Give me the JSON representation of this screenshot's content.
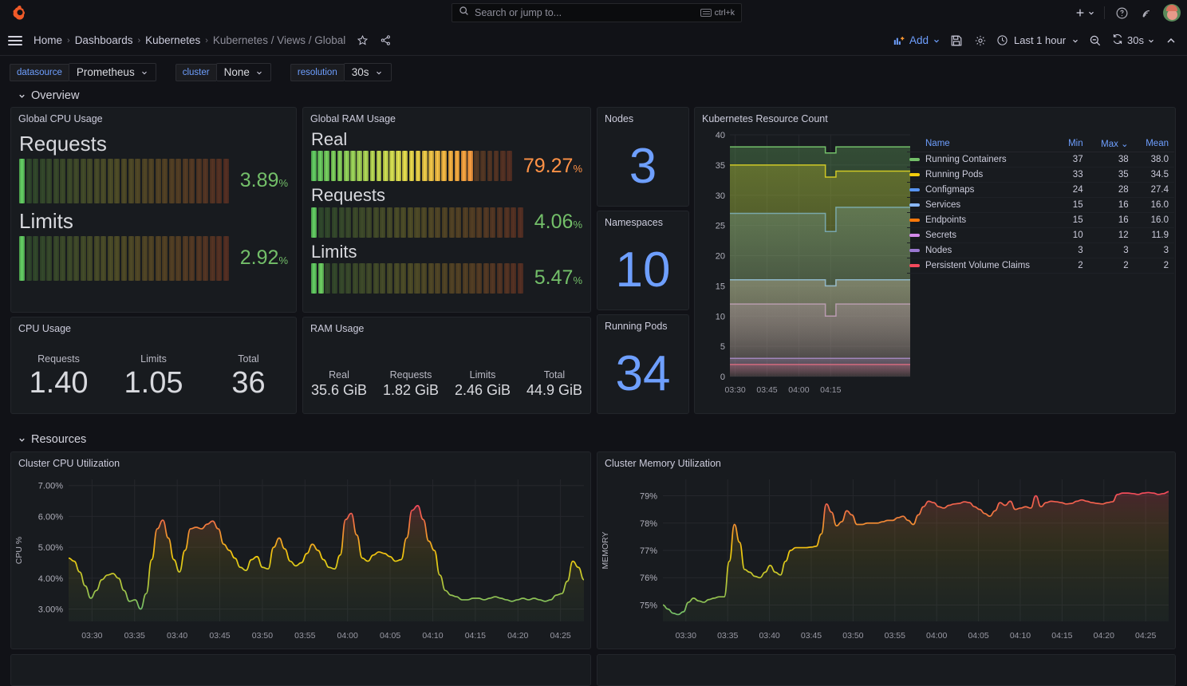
{
  "topnav": {
    "logo_icon": "grafana-logo-icon",
    "search": {
      "placeholder": "Search or jump to...",
      "shortcut": "ctrl+k",
      "icon": "search-icon"
    },
    "add_icon": "plus-icon",
    "help_icon": "help-circle-icon",
    "news_icon": "rss-feed-icon",
    "avatar": "user-avatar"
  },
  "breadcrumb": {
    "menu_icon": "hamburger-menu-icon",
    "items": [
      {
        "label": "Home",
        "current": false
      },
      {
        "label": "Dashboards",
        "current": false
      },
      {
        "label": "Kubernetes",
        "current": false
      },
      {
        "label": "Kubernetes / Views / Global",
        "current": true
      }
    ],
    "separator": "›",
    "star_icon": "star-outline-icon",
    "share_icon": "share-nodes-icon"
  },
  "toolbar": {
    "add_label": "Add",
    "add_icon": "panel-add-icon",
    "save_icon": "save-disk-icon",
    "settings_icon": "gear-icon",
    "time_icon": "clock-icon",
    "time_range": "Last 1 hour",
    "zoom_out_icon": "zoom-out-icon",
    "refresh_icon": "refresh-icon",
    "refresh_interval": "30s",
    "collapse_icon": "chevron-up-icon"
  },
  "variables": [
    {
      "label": "datasource",
      "value": "Prometheus"
    },
    {
      "label": "cluster",
      "value": "None"
    },
    {
      "label": "resolution",
      "value": "30s"
    }
  ],
  "sections": [
    {
      "title": "Overview",
      "collapsed": false
    },
    {
      "title": "Resources",
      "collapsed": false
    }
  ],
  "panels": {
    "global_cpu": {
      "title": "Global CPU Usage",
      "gauges": [
        {
          "label": "Requests",
          "value": "3.89",
          "unit": "%",
          "percent": 3.89,
          "color": "#73bf69"
        },
        {
          "label": "Limits",
          "value": "2.92",
          "unit": "%",
          "percent": 2.92,
          "color": "#73bf69"
        }
      ]
    },
    "global_ram": {
      "title": "Global RAM Usage",
      "gauges": [
        {
          "label": "Real",
          "value": "79.27",
          "unit": "%",
          "percent": 79.27,
          "color": "#ff780a"
        },
        {
          "label": "Requests",
          "value": "4.06",
          "unit": "%",
          "percent": 4.06,
          "color": "#73bf69"
        },
        {
          "label": "Limits",
          "value": "5.47",
          "unit": "%",
          "percent": 5.47,
          "color": "#73bf69"
        }
      ]
    },
    "nodes": {
      "title": "Nodes",
      "value": "3",
      "color": "#6e9fff"
    },
    "namespaces": {
      "title": "Namespaces",
      "value": "10",
      "color": "#6e9fff"
    },
    "running_pods": {
      "title": "Running Pods",
      "value": "34",
      "color": "#6e9fff"
    },
    "cpu_usage": {
      "title": "CPU Usage",
      "stats": [
        {
          "label": "Requests",
          "value": "1.40"
        },
        {
          "label": "Limits",
          "value": "1.05"
        },
        {
          "label": "Total",
          "value": "36"
        }
      ]
    },
    "ram_usage": {
      "title": "RAM Usage",
      "stats": [
        {
          "label": "Real",
          "value": "35.6 GiB"
        },
        {
          "label": "Requests",
          "value": "1.82 GiB"
        },
        {
          "label": "Limits",
          "value": "2.46 GiB"
        },
        {
          "label": "Total",
          "value": "44.9 GiB"
        }
      ]
    },
    "resource_count": {
      "title": "Kubernetes Resource Count"
    },
    "cluster_cpu": {
      "title": "Cluster CPU Utilization"
    },
    "cluster_mem": {
      "title": "Cluster Memory Utilization"
    }
  },
  "chart_data": [
    {
      "id": "resource_count",
      "type": "line",
      "title": "Kubernetes Resource Count",
      "xlabel": "",
      "ylabel": "",
      "ylim": [
        0,
        40
      ],
      "yticks": [
        0,
        5,
        10,
        15,
        20,
        25,
        30,
        35,
        40
      ],
      "xticks": [
        "03:30",
        "03:45",
        "04:00",
        "04:15"
      ],
      "grid": true,
      "legend_position": "right",
      "legend_columns": [
        "Name",
        "Min",
        "Max",
        "Mean"
      ],
      "sort_column": "Max",
      "stepped": true,
      "series": [
        {
          "name": "Running Containers",
          "color": "#73bf69",
          "min": "37",
          "max": "38",
          "mean": "38.0",
          "values": [
            38,
            38,
            38,
            38,
            38,
            38,
            38,
            38,
            38,
            37,
            38,
            38,
            38,
            38,
            38,
            38,
            38,
            38
          ]
        },
        {
          "name": "Running Pods",
          "color": "#f2cc0c",
          "min": "33",
          "max": "35",
          "mean": "34.5",
          "values": [
            35,
            35,
            35,
            35,
            35,
            35,
            35,
            35,
            35,
            33,
            34,
            34,
            34,
            34,
            34,
            34,
            34,
            34
          ]
        },
        {
          "name": "Configmaps",
          "color": "#5794f2",
          "min": "24",
          "max": "28",
          "mean": "27.4",
          "values": [
            27,
            27,
            27,
            27,
            27,
            27,
            27,
            27,
            27,
            24,
            28,
            28,
            28,
            28,
            28,
            28,
            28,
            28
          ]
        },
        {
          "name": "Services",
          "color": "#8ab8ff",
          "min": "15",
          "max": "16",
          "mean": "16.0",
          "values": [
            16,
            16,
            16,
            16,
            16,
            16,
            16,
            16,
            16,
            15,
            16,
            16,
            16,
            16,
            16,
            16,
            16,
            16
          ]
        },
        {
          "name": "Endpoints",
          "color": "#ff780a",
          "min": "15",
          "max": "16",
          "mean": "16.0",
          "values": [
            16,
            16,
            16,
            16,
            16,
            16,
            16,
            16,
            16,
            15,
            16,
            16,
            16,
            16,
            16,
            16,
            16,
            16
          ]
        },
        {
          "name": "Secrets",
          "color": "#d389ea",
          "min": "10",
          "max": "12",
          "mean": "11.9",
          "values": [
            12,
            12,
            12,
            12,
            12,
            12,
            12,
            12,
            12,
            10,
            12,
            12,
            12,
            12,
            12,
            12,
            12,
            12
          ]
        },
        {
          "name": "Nodes",
          "color": "#9a77d1",
          "min": "3",
          "max": "3",
          "mean": "3",
          "values": [
            3,
            3,
            3,
            3,
            3,
            3,
            3,
            3,
            3,
            3,
            3,
            3,
            3,
            3,
            3,
            3,
            3,
            3
          ]
        },
        {
          "name": "Persistent Volume Claims",
          "color": "#f2495c",
          "min": "2",
          "max": "2",
          "mean": "2",
          "values": [
            2,
            2,
            2,
            2,
            2,
            2,
            2,
            2,
            2,
            2,
            2,
            2,
            2,
            2,
            2,
            2,
            2,
            2
          ]
        }
      ]
    },
    {
      "id": "cluster_cpu",
      "type": "area",
      "title": "Cluster CPU Utilization",
      "xlabel": "",
      "ylabel": "CPU %",
      "ylim": [
        2.6,
        7.2
      ],
      "yticks": [
        3.0,
        4.0,
        5.0,
        6.0,
        7.0
      ],
      "ytick_labels": [
        "3.00%",
        "4.00%",
        "5.00%",
        "6.00%",
        "7.00%"
      ],
      "xticks": [
        "03:30",
        "03:35",
        "03:40",
        "03:45",
        "03:50",
        "03:55",
        "04:00",
        "04:05",
        "04:10",
        "04:15",
        "04:20",
        "04:25"
      ],
      "grid": true,
      "gradient_low_color": "#73bf69",
      "gradient_high_color": "#f2495c",
      "values": [
        4.65,
        4.55,
        4.2,
        3.75,
        3.35,
        3.6,
        3.95,
        4.1,
        4.15,
        4.0,
        3.6,
        3.25,
        3.3,
        3.0,
        3.5,
        4.6,
        5.6,
        5.88,
        5.3,
        4.6,
        4.2,
        4.9,
        5.6,
        5.65,
        5.6,
        5.75,
        5.85,
        5.6,
        5.1,
        4.9,
        4.65,
        4.35,
        4.25,
        4.6,
        4.7,
        4.35,
        4.3,
        5.0,
        5.3,
        4.95,
        4.55,
        4.4,
        4.5,
        4.8,
        5.1,
        4.9,
        4.6,
        4.35,
        4.3,
        4.75,
        5.9,
        6.1,
        5.4,
        4.65,
        4.55,
        4.75,
        4.85,
        4.8,
        4.7,
        4.55,
        4.6,
        5.3,
        6.2,
        6.35,
        5.9,
        5.2,
        4.9,
        4.1,
        3.6,
        3.45,
        3.4,
        3.3,
        3.3,
        3.35,
        3.35,
        3.3,
        3.35,
        3.4,
        3.35,
        3.3,
        3.25,
        3.3,
        3.35,
        3.3,
        3.35,
        3.3,
        3.25,
        3.3,
        3.45,
        3.5,
        3.9,
        4.55,
        4.35,
        3.95
      ],
      "x_start": "03:27",
      "x_end": "04:27"
    },
    {
      "id": "cluster_mem",
      "type": "area",
      "title": "Cluster Memory Utilization",
      "xlabel": "",
      "ylabel": "MEMORY",
      "ylim": [
        74.4,
        79.6
      ],
      "yticks": [
        75,
        76,
        77,
        78,
        79
      ],
      "ytick_labels": [
        "75%",
        "76%",
        "77%",
        "78%",
        "79%"
      ],
      "xticks": [
        "03:30",
        "03:35",
        "03:40",
        "03:45",
        "03:50",
        "03:55",
        "04:00",
        "04:05",
        "04:10",
        "04:15",
        "04:20",
        "04:25"
      ],
      "grid": true,
      "gradient_low_color": "#73bf69",
      "gradient_high_color": "#f2495c",
      "values": [
        75.0,
        74.85,
        74.7,
        74.65,
        74.75,
        75.1,
        75.25,
        75.15,
        75.1,
        75.2,
        75.25,
        75.3,
        75.3,
        76.6,
        77.95,
        77.3,
        76.3,
        76.2,
        76.05,
        76.0,
        76.2,
        76.45,
        76.2,
        76.1,
        76.6,
        77.0,
        77.1,
        77.1,
        77.1,
        77.12,
        77.15,
        77.6,
        78.7,
        78.4,
        77.9,
        78.05,
        78.45,
        78.3,
        77.95,
        77.95,
        78.0,
        78.0,
        78.0,
        78.05,
        78.1,
        78.1,
        78.2,
        78.25,
        78.1,
        77.95,
        78.3,
        78.6,
        78.8,
        78.75,
        78.6,
        78.55,
        78.65,
        78.7,
        78.72,
        78.78,
        78.75,
        78.6,
        78.5,
        78.35,
        78.25,
        78.45,
        78.75,
        78.65,
        78.8,
        78.5,
        78.55,
        78.6,
        78.55,
        79.0,
        78.6,
        78.75,
        78.8,
        78.78,
        78.75,
        78.7,
        78.72,
        78.8,
        78.85,
        78.8,
        78.75,
        78.72,
        78.7,
        78.75,
        78.78,
        79.05,
        79.1,
        79.1,
        79.08,
        79.05,
        79.1,
        79.12,
        79.1,
        79.05,
        79.08,
        79.15
      ],
      "x_start": "03:27",
      "x_end": "04:27"
    }
  ]
}
